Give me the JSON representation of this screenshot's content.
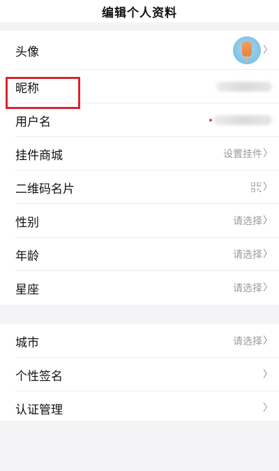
{
  "header": {
    "title": "编辑个人资料"
  },
  "section1": {
    "rows": [
      {
        "label": "头像"
      },
      {
        "label": "昵称"
      },
      {
        "label": "用户名"
      },
      {
        "label": "挂件商城",
        "value": "设置挂件"
      },
      {
        "label": "二维码名片"
      },
      {
        "label": "性别",
        "value": "请选择"
      },
      {
        "label": "年龄",
        "value": "请选择"
      },
      {
        "label": "星座",
        "value": "请选择"
      }
    ]
  },
  "section2": {
    "rows": [
      {
        "label": "城市",
        "value": "请选择"
      },
      {
        "label": "个性签名"
      },
      {
        "label": "认证管理"
      }
    ]
  },
  "icons": {
    "chevron": "chevron-right-icon",
    "qr": "qr-code-icon"
  },
  "colors": {
    "highlight": "#d7262c",
    "background": "#f4f4f6",
    "muted_text": "#9a9a9a"
  }
}
